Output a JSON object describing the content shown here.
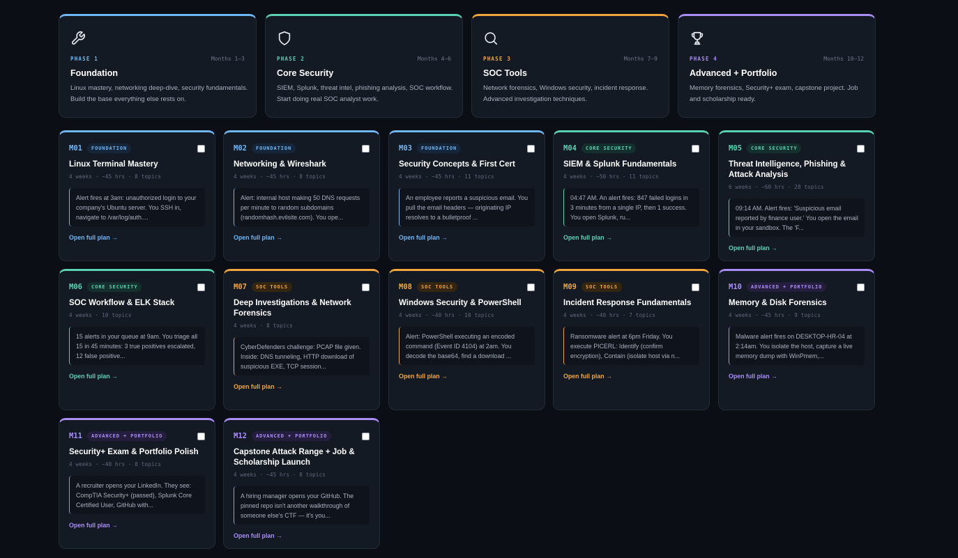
{
  "phases": [
    {
      "tag": "PHASE 1",
      "months": "Months 1–3",
      "title": "Foundation",
      "desc": "Linux mastery, networking deep-dive, security fundamentals. Build the base everything else rests on.",
      "icon": "wrench-icon",
      "color": "#6fb6f5"
    },
    {
      "tag": "PHASE 2",
      "months": "Months 4–6",
      "title": "Core Security",
      "desc": "SIEM, Splunk, threat intel, phishing analysis, SOC workflow. Start doing real SOC analyst work.",
      "icon": "shield-icon",
      "color": "#5ad1b3"
    },
    {
      "tag": "PHASE 3",
      "months": "Months 7–9",
      "title": "SOC Tools",
      "desc": "Network forensics, Windows security, incident response. Advanced investigation techniques.",
      "icon": "search-icon",
      "color": "#f0a63a"
    },
    {
      "tag": "PHASE 4",
      "months": "Months 10–12",
      "title": "Advanced + Portfolio",
      "desc": "Memory forensics, Security+ exam, capstone project. Job and scholarship ready.",
      "icon": "trophy-icon",
      "color": "#a98df5"
    }
  ],
  "modules": [
    {
      "code": "M01",
      "badge": "FOUNDATION",
      "title": "Linux Terminal Mastery",
      "meta": "4 weeks · ~45 hrs · 8 topics",
      "excerpt": "Alert fires at 3am: unauthorized login to your company's Ubuntu server. You SSH in, navigate to /var/log/auth....",
      "link": "Open full plan →"
    },
    {
      "code": "M02",
      "badge": "FOUNDATION",
      "title": "Networking & Wireshark",
      "meta": "4 weeks · ~45 hrs · 8 topics",
      "excerpt": "Alert: internal host making 50 DNS requests per minute to random subdomains (randomhash.evilsite.com). You ope...",
      "link": "Open full plan →"
    },
    {
      "code": "M03",
      "badge": "FOUNDATION",
      "title": "Security Concepts & First Cert",
      "meta": "4 weeks · ~45 hrs · 11 topics",
      "excerpt": "An employee reports a suspicious email. You pull the email headers — originating IP resolves to a bulletproof ...",
      "link": "Open full plan →"
    },
    {
      "code": "M04",
      "badge": "CORE SECURITY",
      "title": "SIEM & Splunk Fundamentals",
      "meta": "4 weeks · ~50 hrs · 11 topics",
      "excerpt": "04:47 AM. An alert fires: 847 failed logins in 3 minutes from a single IP, then 1 success. You open Splunk, ru...",
      "link": "Open full plan →"
    },
    {
      "code": "M05",
      "badge": "CORE SECURITY",
      "title": "Threat Intelligence, Phishing & Attack Analysis",
      "meta": "6 weeks · ~60 hrs · 28 topics",
      "excerpt": "09:14 AM. Alert fires: 'Suspicious email reported by finance user.' You open the email in your sandbox. The 'F...",
      "link": "Open full plan →"
    },
    {
      "code": "M06",
      "badge": "CORE SECURITY",
      "title": "SOC Workflow & ELK Stack",
      "meta": "4 weeks · 10 topics",
      "excerpt": "15 alerts in your queue at 9am. You triage all 15 in 45 minutes: 3 true positives escalated, 12 false positive...",
      "link": "Open full plan →"
    },
    {
      "code": "M07",
      "badge": "SOC TOOLS",
      "title": "Deep Investigations & Network Forensics",
      "meta": "4 weeks · 8 topics",
      "excerpt": "CyberDefenders challenge: PCAP file given. Inside: DNS tunneling, HTTP download of suspicious EXE, TCP session...",
      "link": "Open full plan →"
    },
    {
      "code": "M08",
      "badge": "SOC TOOLS",
      "title": "Windows Security & PowerShell",
      "meta": "4 weeks · ~40 hrs · 10 topics",
      "excerpt": "Alert: PowerShell executing an encoded command (Event ID 4104) at 2am. You decode the base64, find a download ...",
      "link": "Open full plan →"
    },
    {
      "code": "M09",
      "badge": "SOC TOOLS",
      "title": "Incident Response Fundamentals",
      "meta": "4 weeks · ~40 hrs · 7 topics",
      "excerpt": "Ransomware alert at 6pm Friday. You execute PICERL: Identify (confirm encryption), Contain (isolate host via n...",
      "link": "Open full plan →"
    },
    {
      "code": "M10",
      "badge": "ADVANCED + PORTFOLIO",
      "title": "Memory & Disk Forensics",
      "meta": "4 weeks · ~45 hrs · 9 topics",
      "excerpt": "Malware alert fires on DESKTOP-HR-04 at 2:14am. You isolate the host, capture a live memory dump with WinPmem,...",
      "link": "Open full plan →"
    },
    {
      "code": "M11",
      "badge": "ADVANCED + PORTFOLIO",
      "title": "Security+ Exam & Portfolio Polish",
      "meta": "4 weeks · ~40 hrs · 8 topics",
      "excerpt": "A recruiter opens your LinkedIn. They see: CompTIA Security+ (passed), Splunk Core Certified User, GitHub with...",
      "link": "Open full plan →"
    },
    {
      "code": "M12",
      "badge": "ADVANCED + PORTFOLIO",
      "title": "Capstone Attack Range + Job & Scholarship Launch",
      "meta": "4 weeks · ~45 hrs · 8 topics",
      "excerpt": "A hiring manager opens your GitHub. The pinned repo isn't another walkthrough of someone else's CTF — it's you...",
      "link": "Open full plan →"
    }
  ]
}
